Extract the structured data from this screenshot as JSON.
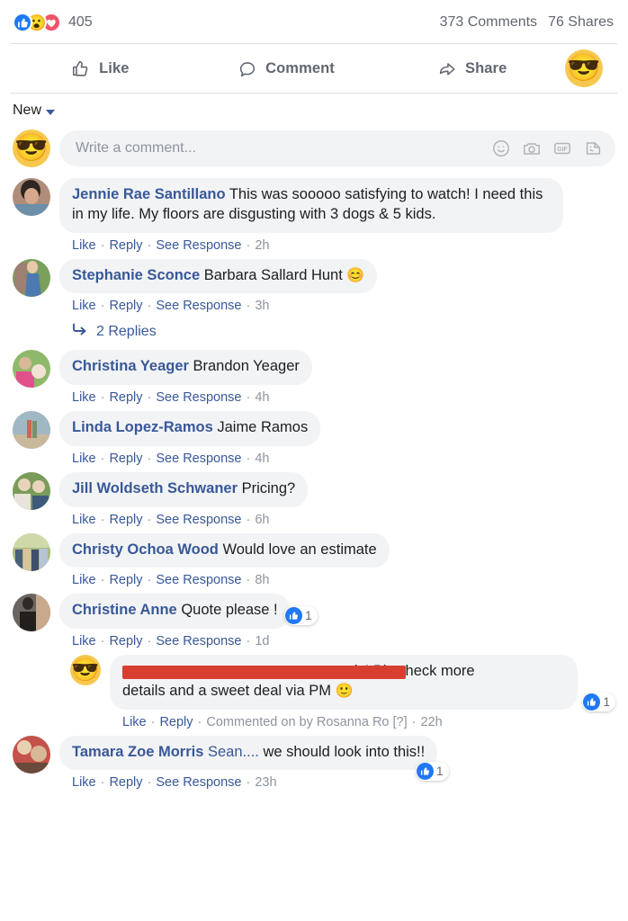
{
  "reactions": {
    "count": "405",
    "icons": [
      "like-reaction-icon",
      "wow-reaction-icon",
      "love-reaction-icon"
    ],
    "wow_glyph": "😮",
    "comments_count": "373 Comments",
    "shares_count": "76 Shares"
  },
  "actions": {
    "like_label": "Like",
    "comment_label": "Comment",
    "share_label": "Share",
    "viewer_avatar_glyph": "😎"
  },
  "sort": {
    "label": "New"
  },
  "composer": {
    "avatar_glyph": "😎",
    "placeholder": "Write a comment...",
    "icons": [
      "emoji-icon",
      "camera-icon",
      "gif-icon",
      "sticker-icon"
    ],
    "gif_label": "GIF"
  },
  "meta_labels": {
    "like": "Like",
    "reply": "Reply",
    "see_response": "See Response",
    "separator": "·"
  },
  "comments": [
    {
      "author": "Jennie Rae Santillano",
      "text": " This was sooooo satisfying to watch! I need this in my life. My floors are disgusting with 3 dogs & 5 kids.",
      "time": "2h",
      "avatar_colors": [
        "#b08d7a",
        "#6d8ea8",
        "#2d2622"
      ],
      "like_count": null
    },
    {
      "author": "Stephanie Sconce",
      "text": " Barbara Sallard Hunt ",
      "emoji": "😊",
      "time": "3h",
      "avatar_colors": [
        "#7aa05c",
        "#e8c9a8",
        "#4c7ab0"
      ],
      "like_count": null,
      "replies_label": "2 Replies"
    },
    {
      "author": "Christina Yeager",
      "text": " Brandon Yeager",
      "time": "4h",
      "avatar_colors": [
        "#8fb96a",
        "#e0508a",
        "#d9b89a"
      ],
      "like_count": null
    },
    {
      "author": "Linda Lopez-Ramos",
      "text": " Jaime Ramos",
      "time": "4h",
      "avatar_colors": [
        "#9fb8c4",
        "#c66a5a",
        "#7d8f6a"
      ],
      "like_count": null
    },
    {
      "author": "Jill Woldseth Schwaner",
      "text": " Pricing?",
      "time": "6h",
      "avatar_colors": [
        "#7a9c5a",
        "#e8e4dc",
        "#3d5a7a"
      ],
      "like_count": null
    },
    {
      "author": "Christy Ochoa Wood",
      "text": " Would love an estimate",
      "time": "8h",
      "avatar_colors": [
        "#a8bb7e",
        "#4a5f7a",
        "#d8c49a"
      ],
      "like_count": null
    },
    {
      "author": "Christine Anne",
      "text": " Quote please !",
      "time": "1d",
      "avatar_colors": [
        "#6b6560",
        "#c9a98c",
        "#2e2a26"
      ],
      "like_count": "1"
    }
  ],
  "reply_comment": {
    "avatar_glyph": "😎",
    "redacted": true,
    "visible_text_line1": "ly! Pls check more",
    "visible_text_line2": "details and a sweet deal via PM ",
    "emoji": "🙂",
    "commented_by": "Commented on by Rosanna Ro [?]",
    "time": "22h",
    "like_count": "1"
  },
  "last_comment": {
    "author": "Tamara Zoe Morris",
    "mention": "Sean....",
    "text": " we should look into this!!",
    "time": "23h",
    "avatar_colors": [
      "#c4524a",
      "#e8d0b0",
      "#6a4a3a"
    ],
    "like_count": "1"
  }
}
